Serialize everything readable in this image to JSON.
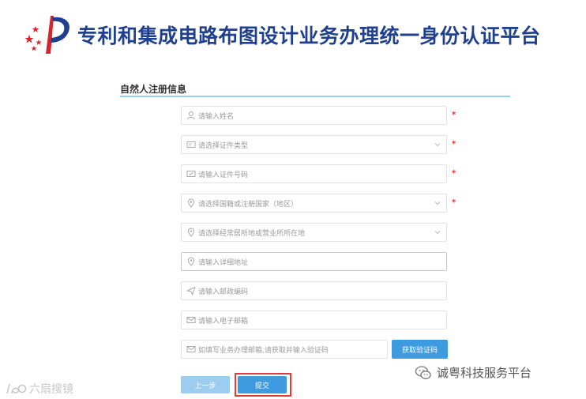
{
  "header": {
    "title": "专利和集成电路布图设计业务办理统一身份认证平台"
  },
  "section": {
    "title": "自然人注册信息"
  },
  "form": {
    "name_placeholder": "请输入姓名",
    "id_type_placeholder": "请选择证件类型",
    "id_number_placeholder": "请输入证件号码",
    "nationality_placeholder": "请选择国籍或注册国家（地区）",
    "residence_placeholder": "请选择经常居所地或营业所所在地",
    "address_placeholder": "请输入详细地址",
    "postcode_placeholder": "请输入邮政编码",
    "email_placeholder": "请输入电子邮箱",
    "code_placeholder": "如填写业务办理邮箱,请获取并输入验证码",
    "required_mark": "*"
  },
  "buttons": {
    "get_code": "获取验证码",
    "prev": "上一步",
    "submit": "提交"
  },
  "watermarks": {
    "left": "六扇搜镜",
    "right": "诚粤科技服务平台"
  },
  "colors": {
    "brand_blue": "#1f3f8f",
    "primary_button": "#3e9be0",
    "disabled_button": "#9ccdf1",
    "required_red": "#e0332e",
    "highlight_red": "#e23b3b",
    "divider": "#8fd3ec"
  },
  "icons": {
    "name": "user-icon",
    "id_type": "id-card-icon",
    "id_number": "id-card-icon",
    "nationality": "location-pin-icon",
    "residence": "location-pin-icon",
    "address": "location-pin-icon",
    "postcode": "send-icon",
    "email": "mail-icon",
    "code": "mail-icon"
  }
}
